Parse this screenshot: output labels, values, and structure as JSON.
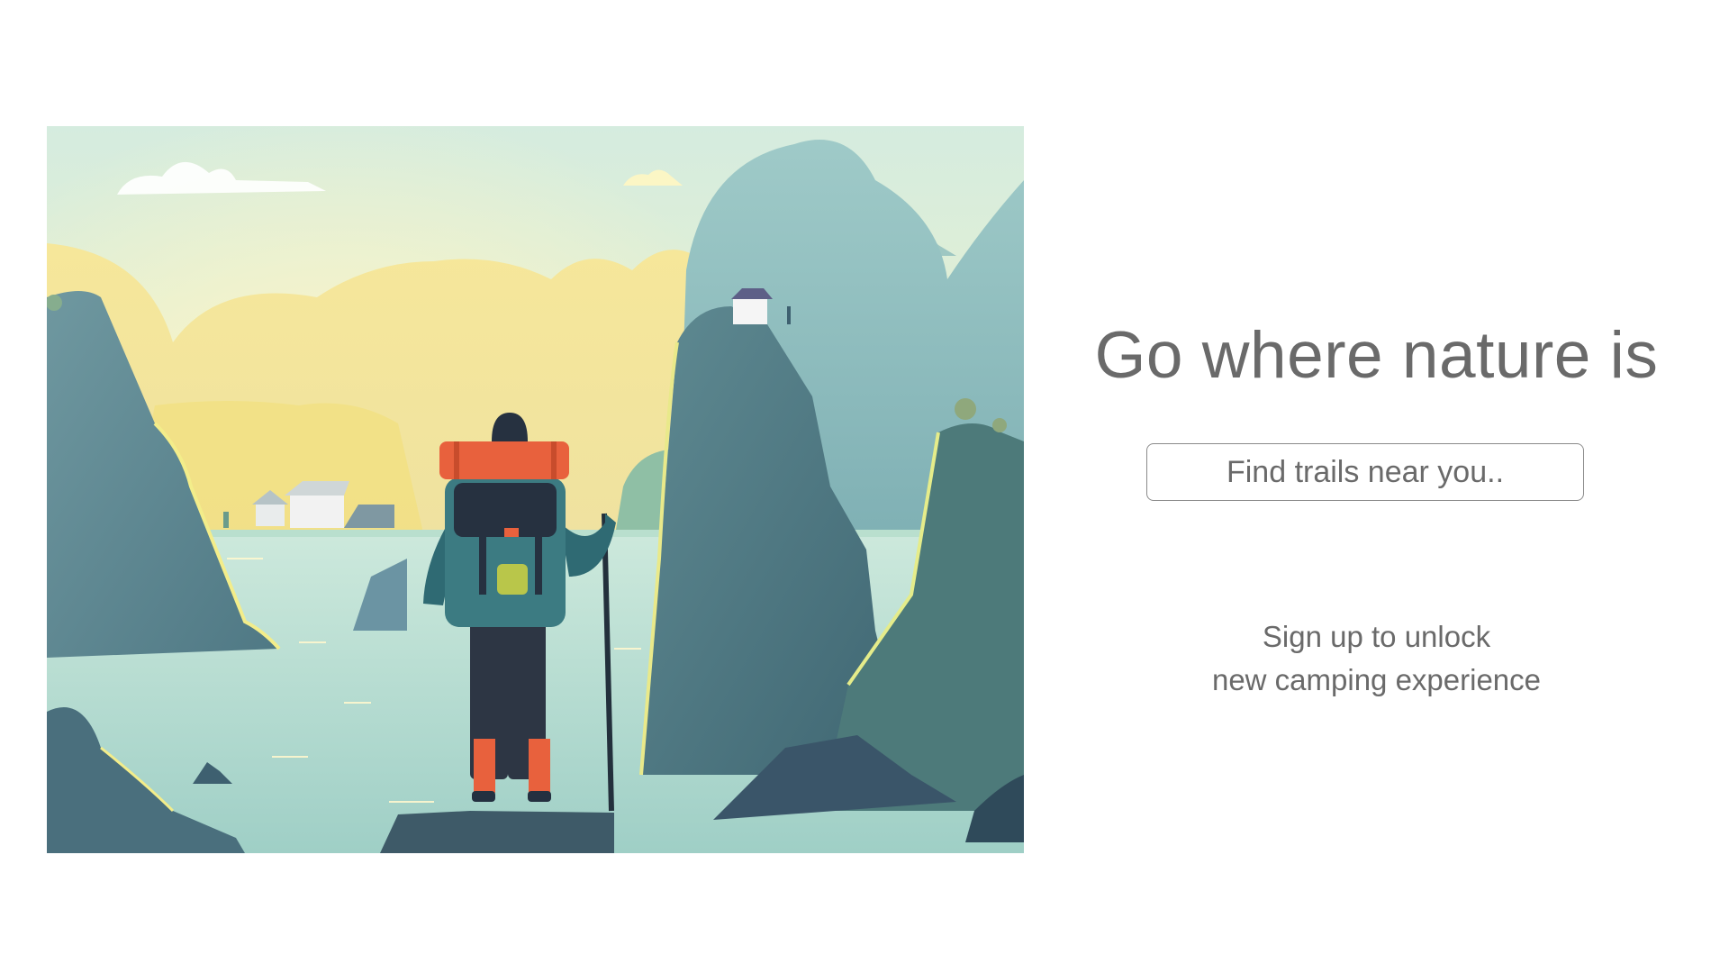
{
  "hero": {
    "image_alt": "Hiker with a backpack standing on a rock overlooking a lake among cliffs"
  },
  "headline": "Go where nature is",
  "search": {
    "placeholder": "Find trails near you.."
  },
  "tagline": {
    "line1": "Sign up to unlock",
    "line2": "new camping experience"
  },
  "colors": {
    "text": "#6a6a6a",
    "search_border": "#8a8a8a",
    "background": "#ffffff"
  }
}
